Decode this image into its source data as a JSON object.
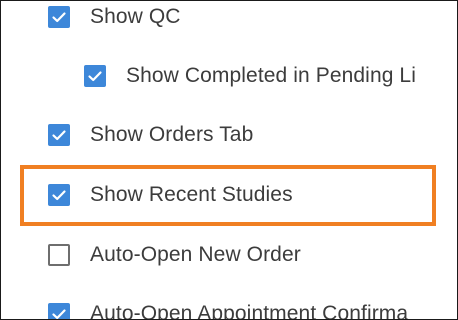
{
  "options": [
    {
      "label": "Show QC",
      "checked": true
    },
    {
      "label": "Show Completed in Pending Li",
      "checked": true
    },
    {
      "label": "Show Orders Tab",
      "checked": true
    },
    {
      "label": "Show Recent Studies",
      "checked": true
    },
    {
      "label": "Auto-Open New Order",
      "checked": false
    },
    {
      "label": "Auto-Open Appointment Confirma",
      "checked": true
    }
  ],
  "colors": {
    "checkbox_checked": "#3d87d9",
    "checkbox_border": "#6e6e6e",
    "highlight_border": "#f07f22",
    "label_text": "#3c3c3c"
  },
  "icons": {
    "checked": "checkmark-icon"
  }
}
